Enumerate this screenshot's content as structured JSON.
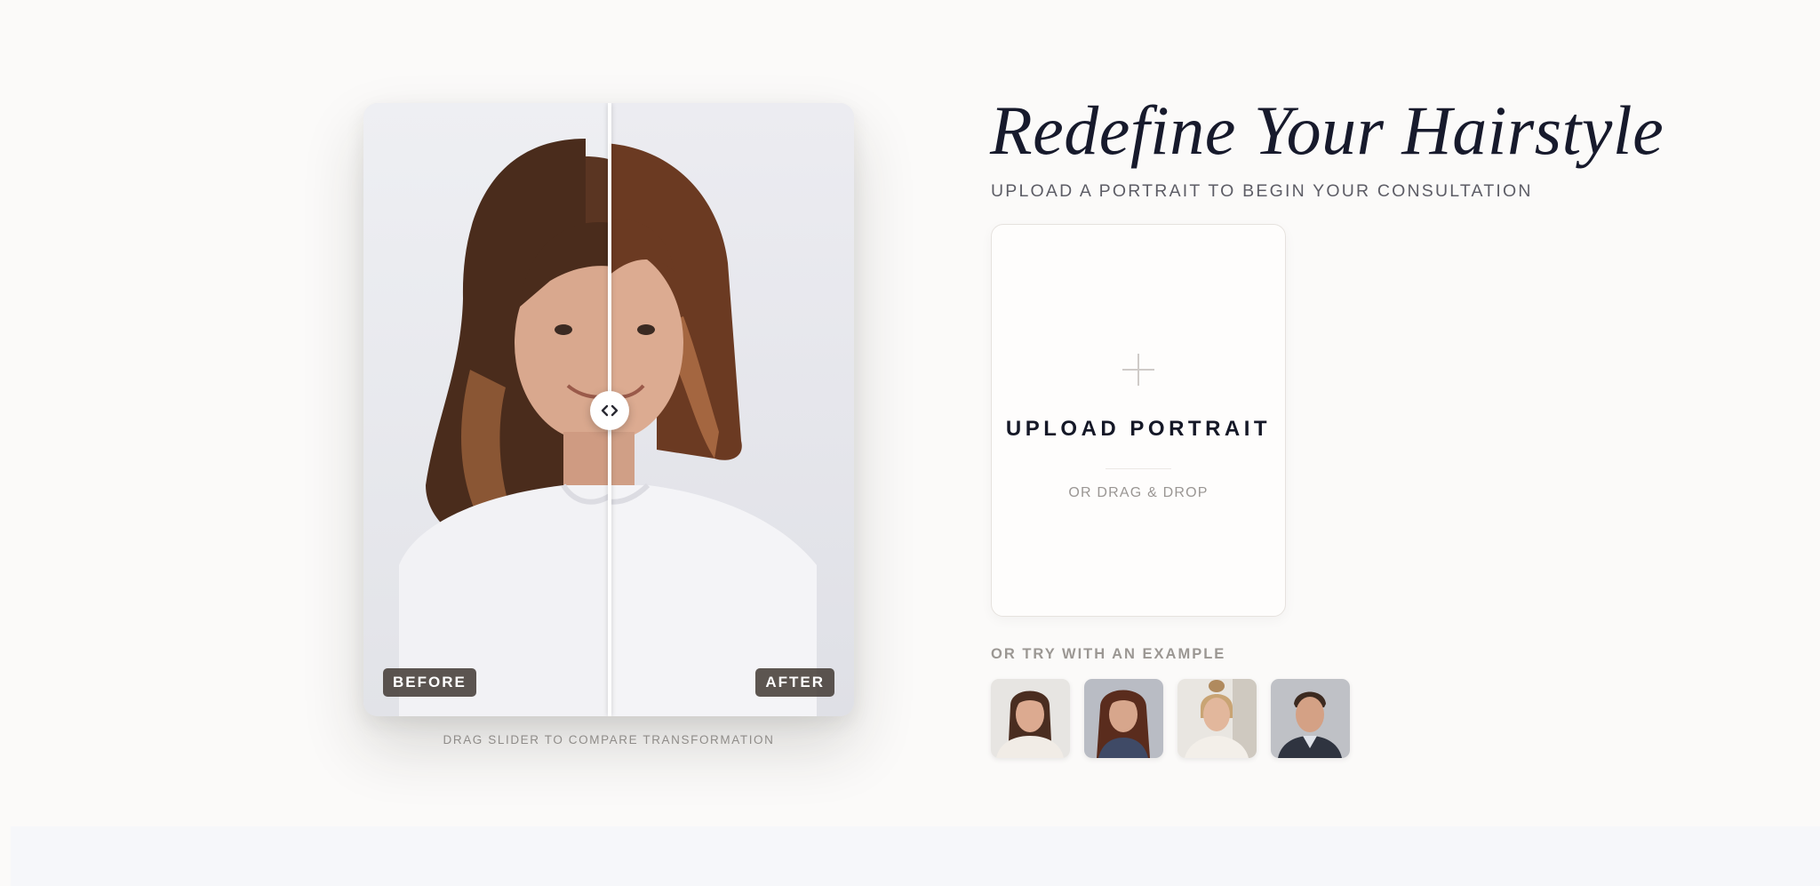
{
  "hero": {
    "title": "Redefine Your Hairstyle",
    "subtitle": "UPLOAD A PORTRAIT TO BEGIN YOUR CONSULTATION"
  },
  "compare": {
    "before_label": "BEFORE",
    "after_label": "AFTER",
    "caption": "DRAG SLIDER TO COMPARE TRANSFORMATION",
    "slider_position": 0.5,
    "handle_icon": "chevrons-left-right-icon"
  },
  "upload": {
    "icon": "plus-icon",
    "label": "UPLOAD PORTRAIT",
    "sublabel": "OR DRAG & DROP"
  },
  "examples": {
    "label": "OR TRY WITH AN EXAMPLE",
    "items": [
      {
        "name": "example-woman-ponytail"
      },
      {
        "name": "example-woman-long-hair"
      },
      {
        "name": "example-woman-blonde-bun"
      },
      {
        "name": "example-man-short-hair"
      }
    ]
  },
  "colors": {
    "background": "#fbfaf9",
    "title": "#171a2c",
    "tag_background": "#4a413b",
    "accent_text": "#9b9793"
  }
}
